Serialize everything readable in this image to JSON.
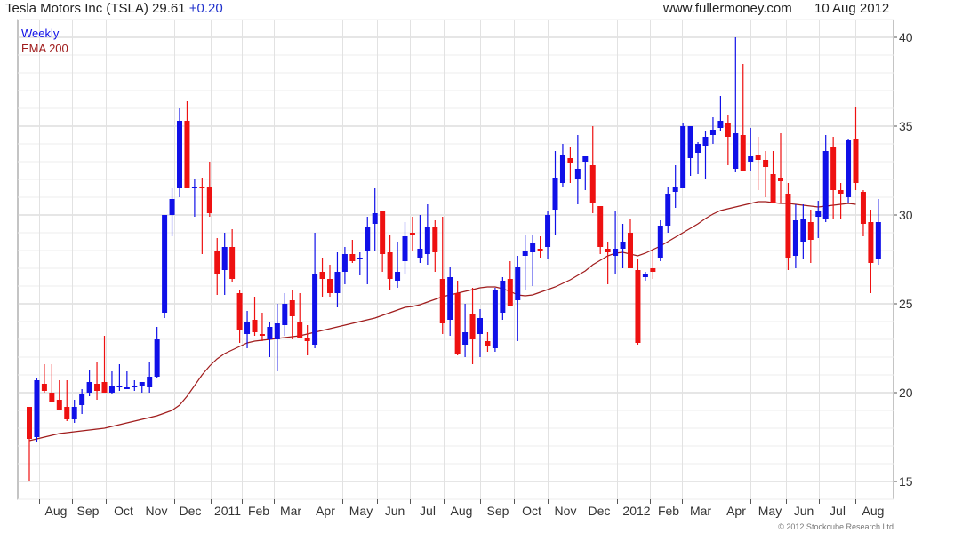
{
  "header": {
    "title": "Tesla Motors Inc (TSLA) 29.61",
    "change": "+0.20",
    "site": "www.fullermoney.com",
    "date": "10 Aug 2012"
  },
  "copyright": "© 2012 Stockcube Research Ltd",
  "colors": {
    "up": "#1010e8",
    "down": "#ee1111",
    "ema": "#a01c1c",
    "grid": "#cccccc"
  },
  "chart_data": {
    "type": "candlestick",
    "interval": "Weekly",
    "indicator": "EMA 200",
    "ylim": [
      14,
      41
    ],
    "y_ticks": [
      15,
      20,
      25,
      30,
      35,
      40
    ],
    "x_ticks": [
      "Aug",
      "Sep",
      "Oct",
      "Nov",
      "Dec",
      "2011",
      "Feb",
      "Mar",
      "Apr",
      "May",
      "Jun",
      "Jul",
      "Aug",
      "Sep",
      "Oct",
      "Nov",
      "Dec",
      "2012",
      "Feb",
      "Mar",
      "Apr",
      "May",
      "Jun",
      "Jul",
      "Aug"
    ],
    "grid": true,
    "legend_position": "top-left",
    "candles": [
      [
        19.2,
        19.2,
        15.0,
        17.4
      ],
      [
        17.5,
        20.8,
        17.2,
        20.7
      ],
      [
        20.5,
        21.6,
        20.0,
        20.1
      ],
      [
        20.0,
        21.6,
        19.8,
        19.5
      ],
      [
        19.6,
        20.7,
        19.0,
        19.0
      ],
      [
        19.2,
        20.7,
        18.4,
        18.5
      ],
      [
        18.5,
        19.6,
        18.3,
        19.2
      ],
      [
        19.3,
        20.2,
        18.8,
        19.9
      ],
      [
        20.0,
        21.3,
        19.8,
        20.6
      ],
      [
        20.5,
        21.7,
        19.6,
        20.1
      ],
      [
        20.6,
        23.2,
        20.0,
        20.0
      ],
      [
        20.0,
        21.2,
        19.9,
        20.4
      ],
      [
        20.4,
        21.6,
        20.1,
        20.4
      ],
      [
        20.3,
        21.2,
        20.2,
        20.3
      ],
      [
        20.3,
        20.7,
        20.1,
        20.4
      ],
      [
        20.4,
        20.6,
        20.0,
        20.6
      ],
      [
        20.3,
        21.7,
        20.0,
        20.9
      ],
      [
        20.9,
        23.7,
        20.8,
        23.0
      ],
      [
        24.5,
        29.8,
        24.2,
        30.0
      ],
      [
        30.0,
        31.5,
        28.8,
        30.9
      ],
      [
        31.5,
        36.0,
        31.0,
        35.3
      ],
      [
        35.3,
        36.4,
        31.5,
        31.5
      ],
      [
        31.5,
        32.0,
        29.9,
        31.6
      ],
      [
        31.6,
        32.1,
        27.8,
        31.5
      ],
      [
        31.6,
        33.0,
        29.9,
        30.1
      ],
      [
        28.0,
        28.7,
        25.5,
        26.7
      ],
      [
        26.9,
        29.0,
        25.5,
        28.2
      ],
      [
        28.2,
        29.2,
        26.2,
        26.4
      ],
      [
        25.6,
        25.8,
        22.8,
        23.5
      ],
      [
        23.3,
        24.6,
        22.5,
        24.0
      ],
      [
        24.1,
        25.4,
        23.2,
        23.4
      ],
      [
        23.3,
        24.5,
        22.9,
        23.2
      ],
      [
        23.0,
        24.0,
        22.0,
        23.7
      ],
      [
        23.0,
        25.0,
        21.2,
        23.9
      ],
      [
        23.8,
        25.6,
        23.2,
        25.0
      ],
      [
        25.2,
        25.8,
        23.0,
        24.3
      ],
      [
        24.0,
        25.6,
        23.1,
        23.1
      ],
      [
        23.1,
        23.8,
        22.1,
        22.9
      ],
      [
        22.7,
        29.0,
        22.5,
        26.7
      ],
      [
        26.8,
        27.6,
        25.4,
        26.4
      ],
      [
        26.4,
        27.2,
        25.4,
        25.6
      ],
      [
        25.6,
        27.9,
        24.8,
        26.8
      ],
      [
        26.8,
        28.2,
        26.1,
        27.8
      ],
      [
        27.8,
        28.6,
        27.3,
        27.4
      ],
      [
        27.6,
        27.9,
        26.6,
        27.6
      ],
      [
        28.0,
        29.9,
        26.1,
        29.3
      ],
      [
        29.5,
        31.5,
        28.0,
        30.1
      ],
      [
        30.2,
        30.2,
        26.8,
        27.8
      ],
      [
        27.9,
        28.9,
        25.8,
        26.4
      ],
      [
        26.3,
        28.5,
        25.9,
        26.8
      ],
      [
        27.4,
        29.6,
        26.7,
        28.8
      ],
      [
        29.0,
        29.9,
        28.0,
        28.9
      ],
      [
        27.6,
        30.0,
        27.3,
        28.1
      ],
      [
        27.8,
        30.6,
        27.2,
        29.3
      ],
      [
        29.3,
        29.7,
        26.8,
        27.9
      ],
      [
        26.4,
        29.9,
        23.3,
        23.9
      ],
      [
        24.1,
        27.1,
        23.2,
        26.5
      ],
      [
        25.6,
        26.3,
        22.1,
        22.2
      ],
      [
        22.7,
        25.0,
        22.0,
        23.4
      ],
      [
        24.4,
        25.9,
        21.6,
        23.0
      ],
      [
        23.3,
        24.7,
        22.0,
        24.2
      ],
      [
        22.9,
        23.4,
        22.3,
        22.6
      ],
      [
        22.5,
        25.9,
        22.3,
        25.8
      ],
      [
        24.5,
        26.5,
        24.1,
        26.3
      ],
      [
        26.4,
        27.4,
        25.2,
        24.9
      ],
      [
        25.2,
        27.7,
        22.9,
        27.1
      ],
      [
        27.7,
        28.9,
        25.8,
        28.0
      ],
      [
        27.9,
        28.9,
        26.0,
        28.4
      ],
      [
        28.1,
        28.8,
        27.6,
        28.0
      ],
      [
        28.2,
        30.2,
        27.5,
        30.0
      ],
      [
        30.3,
        33.6,
        28.9,
        32.1
      ],
      [
        31.8,
        34.0,
        31.6,
        33.4
      ],
      [
        33.2,
        33.8,
        31.8,
        32.9
      ],
      [
        32.0,
        34.5,
        30.6,
        32.6
      ],
      [
        33.0,
        33.3,
        31.4,
        33.3
      ],
      [
        32.8,
        35.0,
        30.1,
        30.7
      ],
      [
        30.5,
        30.5,
        27.8,
        28.2
      ],
      [
        28.1,
        28.5,
        26.1,
        27.9
      ],
      [
        27.7,
        30.2,
        26.7,
        28.1
      ],
      [
        28.1,
        29.5,
        27.0,
        28.5
      ],
      [
        29.0,
        29.8,
        27.4,
        27.0
      ],
      [
        26.9,
        27.5,
        22.7,
        22.8
      ],
      [
        26.5,
        26.8,
        26.3,
        26.7
      ],
      [
        27.0,
        28.1,
        26.4,
        26.8
      ],
      [
        27.6,
        29.7,
        27.4,
        29.4
      ],
      [
        29.4,
        31.6,
        29.0,
        31.2
      ],
      [
        31.3,
        32.8,
        30.4,
        31.6
      ],
      [
        31.5,
        35.2,
        31.5,
        35.0
      ],
      [
        33.2,
        35.0,
        32.2,
        35.0
      ],
      [
        33.5,
        34.1,
        32.3,
        34.0
      ],
      [
        33.9,
        34.7,
        32.0,
        34.4
      ],
      [
        34.5,
        35.5,
        34.0,
        34.8
      ],
      [
        34.9,
        36.7,
        34.7,
        35.3
      ],
      [
        35.2,
        35.6,
        32.8,
        34.4
      ],
      [
        32.6,
        40.0,
        32.4,
        34.6
      ],
      [
        34.5,
        38.5,
        33.2,
        32.5
      ],
      [
        33.0,
        34.9,
        32.5,
        33.3
      ],
      [
        33.4,
        34.4,
        31.4,
        33.1
      ],
      [
        33.1,
        33.6,
        31.0,
        32.7
      ],
      [
        32.3,
        33.6,
        31.4,
        30.7
      ],
      [
        32.1,
        34.6,
        30.7,
        31.9
      ],
      [
        31.2,
        31.8,
        26.9,
        27.6
      ],
      [
        27.7,
        30.6,
        27.0,
        29.7
      ],
      [
        28.5,
        30.6,
        27.5,
        29.8
      ],
      [
        29.6,
        30.3,
        27.3,
        28.6
      ],
      [
        29.9,
        30.8,
        28.7,
        30.2
      ],
      [
        29.8,
        34.5,
        29.6,
        33.6
      ],
      [
        33.8,
        34.4,
        29.8,
        31.4
      ],
      [
        31.4,
        31.8,
        29.8,
        31.2
      ],
      [
        31.0,
        34.3,
        30.7,
        34.2
      ],
      [
        34.3,
        36.1,
        31.4,
        31.8
      ],
      [
        31.3,
        31.4,
        28.8,
        29.5
      ],
      [
        29.6,
        30.3,
        25.6,
        27.3
      ],
      [
        27.5,
        30.9,
        27.2,
        29.6
      ]
    ],
    "ema": [
      17.3,
      17.4,
      17.5,
      17.6,
      17.7,
      17.75,
      17.8,
      17.85,
      17.9,
      17.95,
      18.0,
      18.1,
      18.2,
      18.3,
      18.4,
      18.5,
      18.6,
      18.7,
      18.85,
      19.0,
      19.3,
      19.8,
      20.4,
      21.0,
      21.5,
      21.9,
      22.2,
      22.4,
      22.6,
      22.8,
      22.9,
      22.95,
      23.0,
      23.05,
      23.1,
      23.15,
      23.2,
      23.3,
      23.4,
      23.5,
      23.6,
      23.7,
      23.8,
      23.9,
      24.0,
      24.1,
      24.2,
      24.35,
      24.5,
      24.65,
      24.8,
      24.85,
      24.95,
      25.1,
      25.25,
      25.4,
      25.5,
      25.6,
      25.7,
      25.8,
      25.9,
      25.95,
      25.95,
      25.85,
      25.7,
      25.5,
      25.45,
      25.5,
      25.65,
      25.8,
      25.95,
      26.15,
      26.35,
      26.6,
      26.85,
      27.2,
      27.45,
      27.7,
      27.85,
      27.9,
      27.8,
      27.7,
      27.85,
      28.05,
      28.25,
      28.5,
      28.75,
      29.0,
      29.25,
      29.5,
      29.8,
      30.05,
      30.25,
      30.35,
      30.45,
      30.55,
      30.65,
      30.75,
      30.75,
      30.7,
      30.65,
      30.65,
      30.6,
      30.55,
      30.5,
      30.45,
      30.5,
      30.55,
      30.6,
      30.65,
      30.6
    ]
  },
  "labels": {
    "interval": "Weekly",
    "indicator": "EMA 200"
  }
}
